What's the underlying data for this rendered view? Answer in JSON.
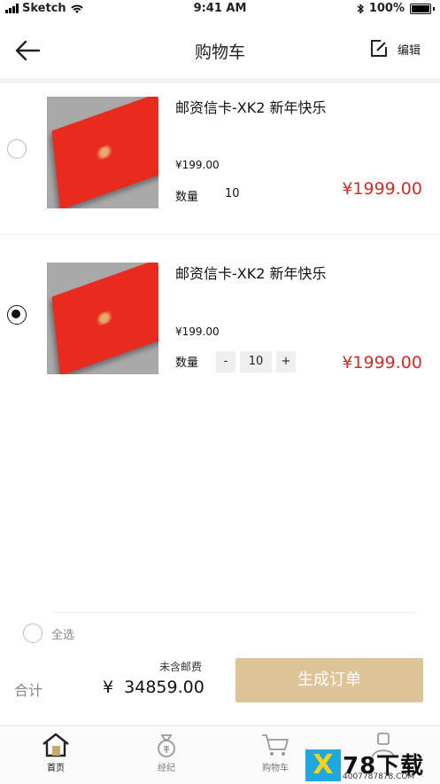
{
  "status_bar": {
    "carrier": "Sketch",
    "time": "9:41 AM",
    "battery": "100%"
  },
  "header": {
    "title": "购物车",
    "edit_label": "编辑"
  },
  "cart": {
    "items": [
      {
        "title": "邮资信卡-XK2 新年快乐",
        "unit_price": "¥199.00",
        "qty_label": "数量",
        "quantity": "10",
        "total": "¥1999.00",
        "selected": false
      },
      {
        "title": "邮资信卡-XK2 新年快乐",
        "unit_price": "¥199.00",
        "qty_label": "数量",
        "quantity": "10",
        "minus": "-",
        "plus": "+",
        "total": "¥1999.00",
        "selected": true
      }
    ]
  },
  "footer": {
    "select_all": "全选",
    "total_label": "合计",
    "shipping_note": "未含邮费",
    "total_amount": "¥  34859.00",
    "order_button": "生成订单"
  },
  "tabbar": {
    "tabs": [
      {
        "label": "首页",
        "icon": "home-icon",
        "active": true
      },
      {
        "label": "经纪",
        "icon": "money-bag-icon",
        "active": false
      },
      {
        "label": "购物车",
        "icon": "cart-icon",
        "active": false
      },
      {
        "label": "",
        "icon": "user-icon",
        "active": false
      }
    ]
  },
  "watermark": {
    "logo": "X",
    "brand": "78下载",
    "url": "4007787878.COM"
  }
}
